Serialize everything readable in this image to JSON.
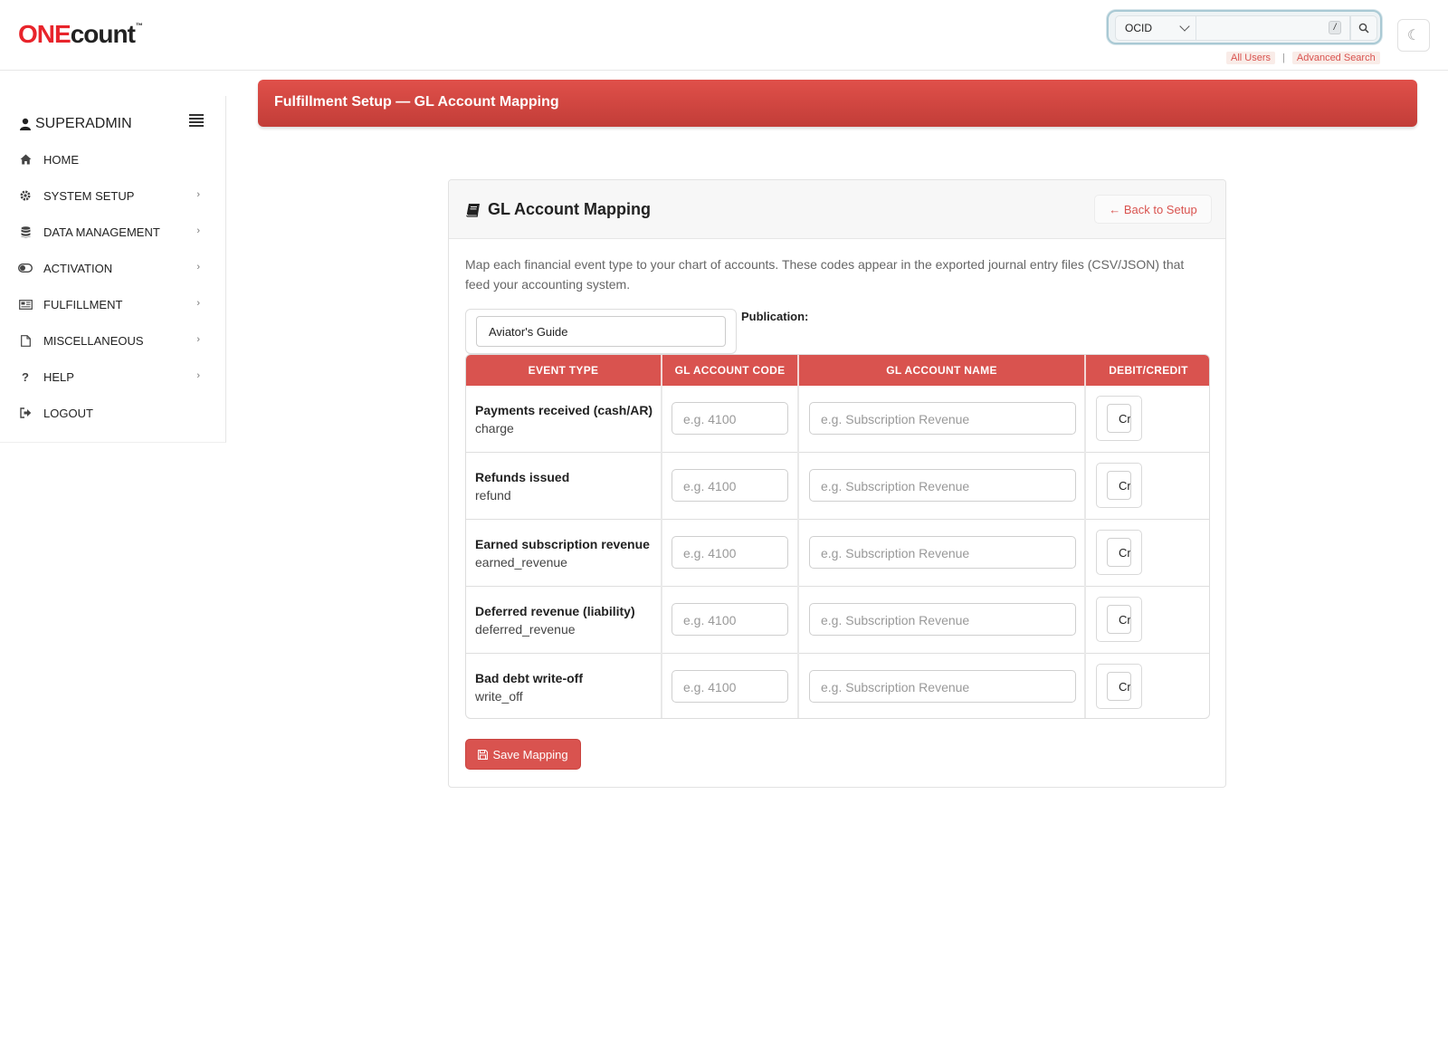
{
  "brand": {
    "logo_one": "ONE",
    "logo_count": "count",
    "logo_tm": "™"
  },
  "search": {
    "type_selected": "OCID",
    "input_value": "",
    "shortcut_key": "/",
    "icon": "search-icon"
  },
  "quick_links": {
    "all_users": "All Users",
    "separator": "|",
    "advanced_search": "Advanced Search"
  },
  "theme_toggle": {
    "icon": "moon-icon",
    "glyph": "☾"
  },
  "sidebar": {
    "username": "SUPERADMIN",
    "items": [
      {
        "label": "HOME",
        "icon": "home-icon",
        "has_submenu": false
      },
      {
        "label": "SYSTEM SETUP",
        "icon": "gear-icon",
        "has_submenu": true
      },
      {
        "label": "DATA MANAGEMENT",
        "icon": "database-icon",
        "has_submenu": true
      },
      {
        "label": "ACTIVATION",
        "icon": "toggle-icon",
        "has_submenu": true
      },
      {
        "label": "FULFILLMENT",
        "icon": "newspaper-icon",
        "has_submenu": true
      },
      {
        "label": "MISCELLANEOUS",
        "icon": "file-icon",
        "has_submenu": true
      },
      {
        "label": "HELP",
        "icon": "question-icon",
        "has_submenu": true
      },
      {
        "label": "LOGOUT",
        "icon": "logout-icon",
        "has_submenu": false
      }
    ],
    "submenu_chevron": "›"
  },
  "banner": {
    "title": "Fulfillment Setup — GL Account Mapping"
  },
  "card": {
    "title": "GL Account Mapping",
    "back_label": "← Back to Setup",
    "description": "Map each financial event type to your chart of accounts. These codes appear in the exported journal entry files (CSV/JSON) that feed your accounting system.",
    "publication_label": "Publication:",
    "publication_selected": "Aviator's Guide",
    "save_label": "Save Mapping"
  },
  "table": {
    "headers": [
      "EVENT TYPE",
      "GL ACCOUNT CODE",
      "GL ACCOUNT NAME",
      "DEBIT/CREDIT"
    ],
    "code_placeholder": "e.g. 4100",
    "name_placeholder": "e.g. Subscription Revenue",
    "rows": [
      {
        "name": "Payments received (cash/AR)",
        "code": "charge",
        "gl_code": "",
        "gl_name": "",
        "debit_credit": "Credit"
      },
      {
        "name": "Refunds issued",
        "code": "refund",
        "gl_code": "",
        "gl_name": "",
        "debit_credit": "Credit"
      },
      {
        "name": "Earned subscription revenue",
        "code": "earned_revenue",
        "gl_code": "",
        "gl_name": "",
        "debit_credit": "Credit"
      },
      {
        "name": "Deferred revenue (liability)",
        "code": "deferred_revenue",
        "gl_code": "",
        "gl_name": "",
        "debit_credit": "Credit"
      },
      {
        "name": "Bad debt write-off",
        "code": "write_off",
        "gl_code": "",
        "gl_name": "",
        "debit_credit": "Credit"
      }
    ]
  },
  "colors": {
    "accent": "#d9534f",
    "banner_top": "#e0504a",
    "banner_bottom": "#c23d38",
    "logo_red": "#e8242b"
  }
}
